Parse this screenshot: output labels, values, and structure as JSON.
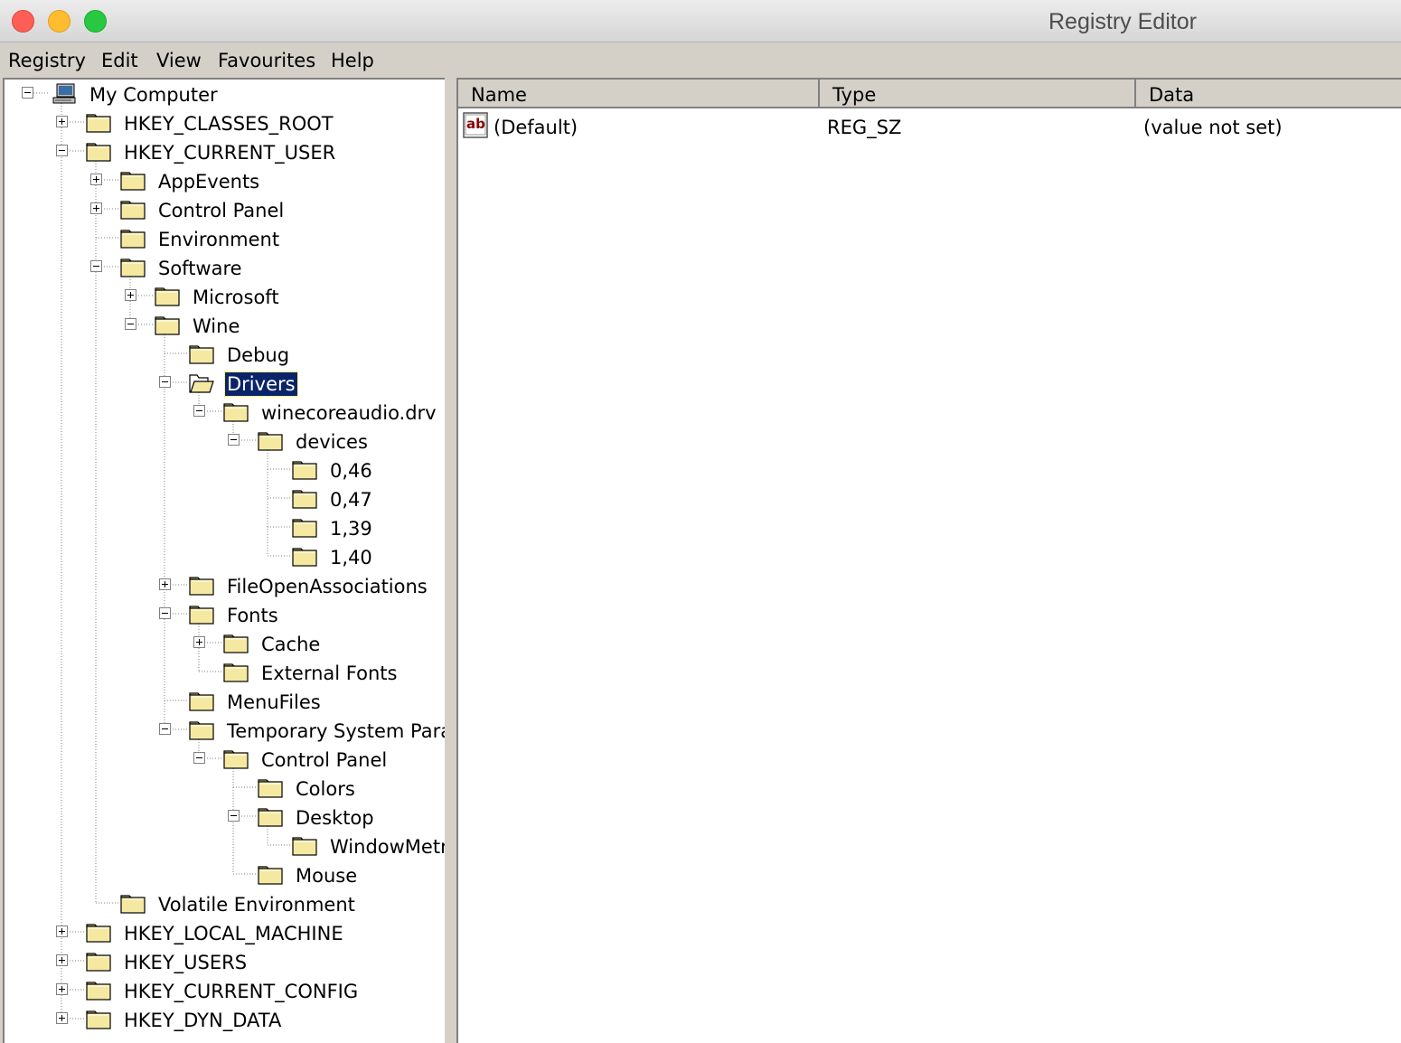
{
  "window": {
    "title": "Registry Editor"
  },
  "menu": [
    "Registry",
    "Edit",
    "View",
    "Favourites",
    "Help"
  ],
  "tree": [
    {
      "label": "My Computer",
      "icon": "computer-icon",
      "expanded": true
    },
    {
      "label": "HKEY_CLASSES_ROOT",
      "icon": "folder-icon",
      "expanded": false
    },
    {
      "label": "HKEY_CURRENT_USER",
      "icon": "folder-icon",
      "expanded": true
    },
    {
      "label": "AppEvents",
      "icon": "folder-icon",
      "expanded": false
    },
    {
      "label": "Control Panel",
      "icon": "folder-icon",
      "expanded": false
    },
    {
      "label": "Environment",
      "icon": "folder-icon"
    },
    {
      "label": "Software",
      "icon": "folder-icon",
      "expanded": true
    },
    {
      "label": "Microsoft",
      "icon": "folder-icon",
      "expanded": false
    },
    {
      "label": "Wine",
      "icon": "folder-icon",
      "expanded": true
    },
    {
      "label": "Debug",
      "icon": "folder-icon"
    },
    {
      "label": "Drivers",
      "icon": "open-folder-icon",
      "expanded": true,
      "selected": true
    },
    {
      "label": "winecoreaudio.drv",
      "icon": "folder-icon",
      "expanded": true
    },
    {
      "label": "devices",
      "icon": "folder-icon",
      "expanded": true
    },
    {
      "label": "0,46",
      "icon": "folder-icon"
    },
    {
      "label": "0,47",
      "icon": "folder-icon"
    },
    {
      "label": "1,39",
      "icon": "folder-icon"
    },
    {
      "label": "1,40",
      "icon": "folder-icon"
    },
    {
      "label": "FileOpenAssociations",
      "icon": "folder-icon",
      "expanded": false
    },
    {
      "label": "Fonts",
      "icon": "folder-icon",
      "expanded": true
    },
    {
      "label": "Cache",
      "icon": "folder-icon",
      "expanded": false
    },
    {
      "label": "External Fonts",
      "icon": "folder-icon"
    },
    {
      "label": "MenuFiles",
      "icon": "folder-icon"
    },
    {
      "label": "Temporary System Paramet",
      "icon": "folder-icon",
      "expanded": true
    },
    {
      "label": "Control Panel",
      "icon": "folder-icon",
      "expanded": true
    },
    {
      "label": "Colors",
      "icon": "folder-icon"
    },
    {
      "label": "Desktop",
      "icon": "folder-icon",
      "expanded": true
    },
    {
      "label": "WindowMetrics",
      "icon": "folder-icon"
    },
    {
      "label": "Mouse",
      "icon": "folder-icon"
    },
    {
      "label": "Volatile Environment",
      "icon": "folder-icon"
    },
    {
      "label": "HKEY_LOCAL_MACHINE",
      "icon": "folder-icon",
      "expanded": false
    },
    {
      "label": "HKEY_USERS",
      "icon": "folder-icon",
      "expanded": false
    },
    {
      "label": "HKEY_CURRENT_CONFIG",
      "icon": "folder-icon",
      "expanded": false
    },
    {
      "label": "HKEY_DYN_DATA",
      "icon": "folder-icon",
      "expanded": false
    }
  ],
  "list": {
    "columns": [
      "Name",
      "Type",
      "Data"
    ],
    "rows": [
      {
        "icon": "string-value-icon",
        "name": "(Default)",
        "type": "REG_SZ",
        "data": "(value not set)"
      }
    ]
  },
  "colors": {
    "selection": "#0a246a",
    "folder": "#f5e9a2",
    "chrome": "#d4d0c8"
  }
}
